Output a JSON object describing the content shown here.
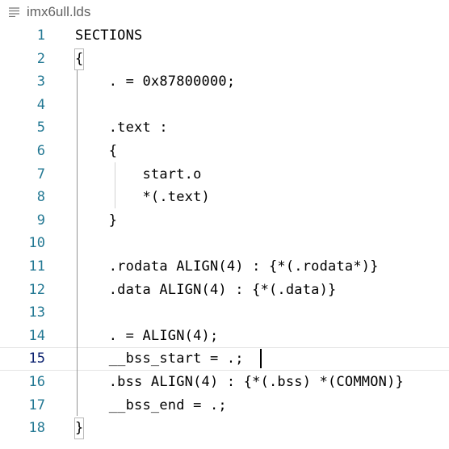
{
  "tab": {
    "icon": "lines-file-icon",
    "filename": "imx6ull.lds"
  },
  "editor": {
    "current_line": 15,
    "lines": [
      {
        "number": "1",
        "text": "SECTIONS"
      },
      {
        "number": "2",
        "text": "{"
      },
      {
        "number": "3",
        "text": "    . = 0x87800000;"
      },
      {
        "number": "4",
        "text": ""
      },
      {
        "number": "5",
        "text": "    .text :"
      },
      {
        "number": "6",
        "text": "    {"
      },
      {
        "number": "7",
        "text": "        start.o"
      },
      {
        "number": "8",
        "text": "        *(.text)"
      },
      {
        "number": "9",
        "text": "    }"
      },
      {
        "number": "10",
        "text": ""
      },
      {
        "number": "11",
        "text": "    .rodata ALIGN(4) : {*(.rodata*)}"
      },
      {
        "number": "12",
        "text": "    .data ALIGN(4) : {*(.data)}"
      },
      {
        "number": "13",
        "text": ""
      },
      {
        "number": "14",
        "text": "    . = ALIGN(4);"
      },
      {
        "number": "15",
        "text": "    __bss_start = .;"
      },
      {
        "number": "16",
        "text": "    .bss ALIGN(4) : {*(.bss) *(COMMON)}"
      },
      {
        "number": "17",
        "text": "    __bss_end = .;"
      },
      {
        "number": "18",
        "text": "}"
      }
    ]
  }
}
